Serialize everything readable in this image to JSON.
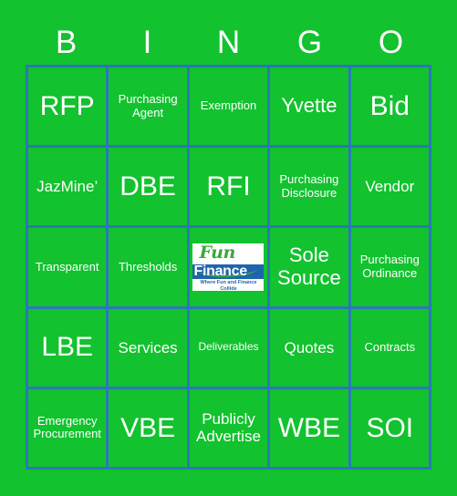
{
  "colors": {
    "background_green": "#12c22e",
    "cell_green": "#12c22e",
    "grid_border_blue": "#2a78b8",
    "text_white": "#ffffff",
    "logo_green": "#3aa837",
    "logo_blue": "#1f64ad"
  },
  "header": {
    "letters": [
      "B",
      "I",
      "N",
      "G",
      "O"
    ]
  },
  "grid": {
    "rows": [
      [
        {
          "label": "RFP",
          "size": "xl"
        },
        {
          "label": "Purchasing\nAgent",
          "size": "sm"
        },
        {
          "label": "Exemption",
          "size": "sm"
        },
        {
          "label": "Yvette",
          "size": "lg"
        },
        {
          "label": "Bid",
          "size": "xl"
        }
      ],
      [
        {
          "label": "JazMine’",
          "size": "md"
        },
        {
          "label": "DBE",
          "size": "xl"
        },
        {
          "label": "RFI",
          "size": "xl"
        },
        {
          "label": "Purchasing\nDisclosure",
          "size": "sm"
        },
        {
          "label": "Vendor",
          "size": "md"
        }
      ],
      [
        {
          "label": "Transparent",
          "size": "sm"
        },
        {
          "label": "Thresholds",
          "size": "sm"
        },
        {
          "label": "",
          "size": "md",
          "free": true
        },
        {
          "label": "Sole\nSource",
          "size": "lg"
        },
        {
          "label": "Purchasing\nOrdinance",
          "size": "sm"
        }
      ],
      [
        {
          "label": "LBE",
          "size": "xl"
        },
        {
          "label": "Services",
          "size": "md"
        },
        {
          "label": "Deliverables",
          "size": "xs"
        },
        {
          "label": "Quotes",
          "size": "md"
        },
        {
          "label": "Contracts",
          "size": "sm"
        }
      ],
      [
        {
          "label": "Emergency\nProcurement",
          "size": "sm"
        },
        {
          "label": "VBE",
          "size": "xl"
        },
        {
          "label": "Publicly\nAdvertise",
          "size": "md"
        },
        {
          "label": "WBE",
          "size": "xl"
        },
        {
          "label": "SOI",
          "size": "xl"
        }
      ]
    ]
  },
  "free_space": {
    "logo_word_1": "Fun",
    "logo_word_2": "Finance",
    "logo_tagline": "Where Fun and Finance Collide"
  }
}
